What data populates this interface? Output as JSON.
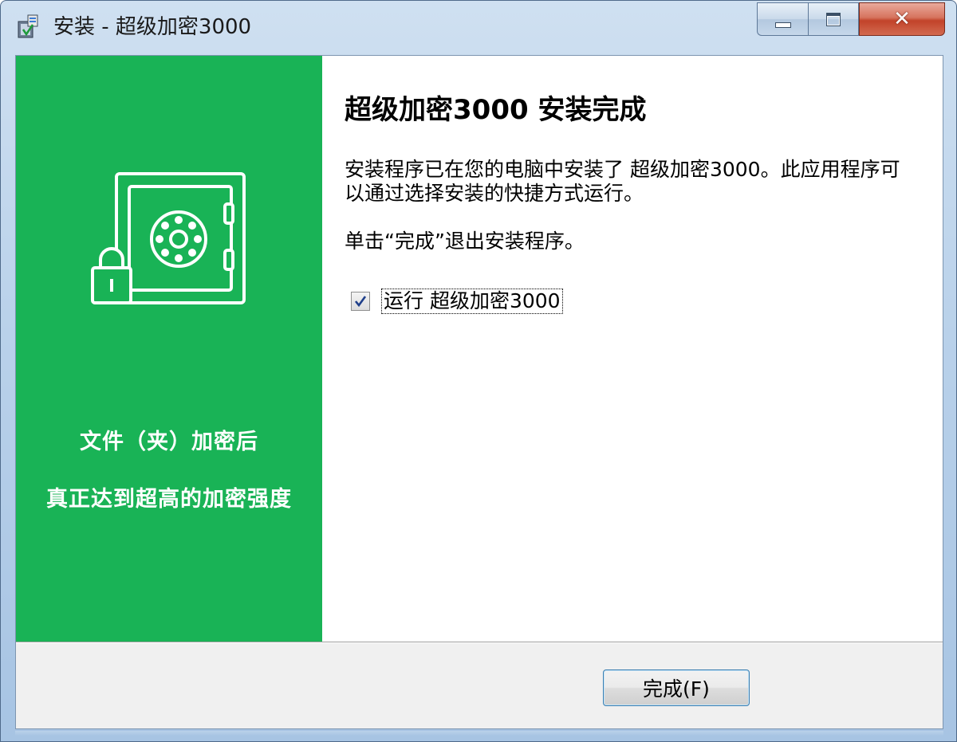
{
  "window": {
    "title": "安装 - 超级加密3000"
  },
  "sidebar": {
    "line1": "文件（夹）加密后",
    "line2": "真正达到超高的加密强度"
  },
  "content": {
    "heading": "超级加密3000 安装完成",
    "paragraph1": "安装程序已在您的电脑中安装了 超级加密3000。此应用程序可以通过选择安装的快捷方式运行。",
    "paragraph2": "单击“完成”退出安装程序。",
    "run_checkbox": {
      "label": "运行 超级加密3000",
      "checked": true
    }
  },
  "footer": {
    "finish_label": "完成(F)"
  },
  "colors": {
    "sidebar_green": "#19b356",
    "window_frame": "#b9d1ea",
    "close_red": "#c2432a"
  }
}
